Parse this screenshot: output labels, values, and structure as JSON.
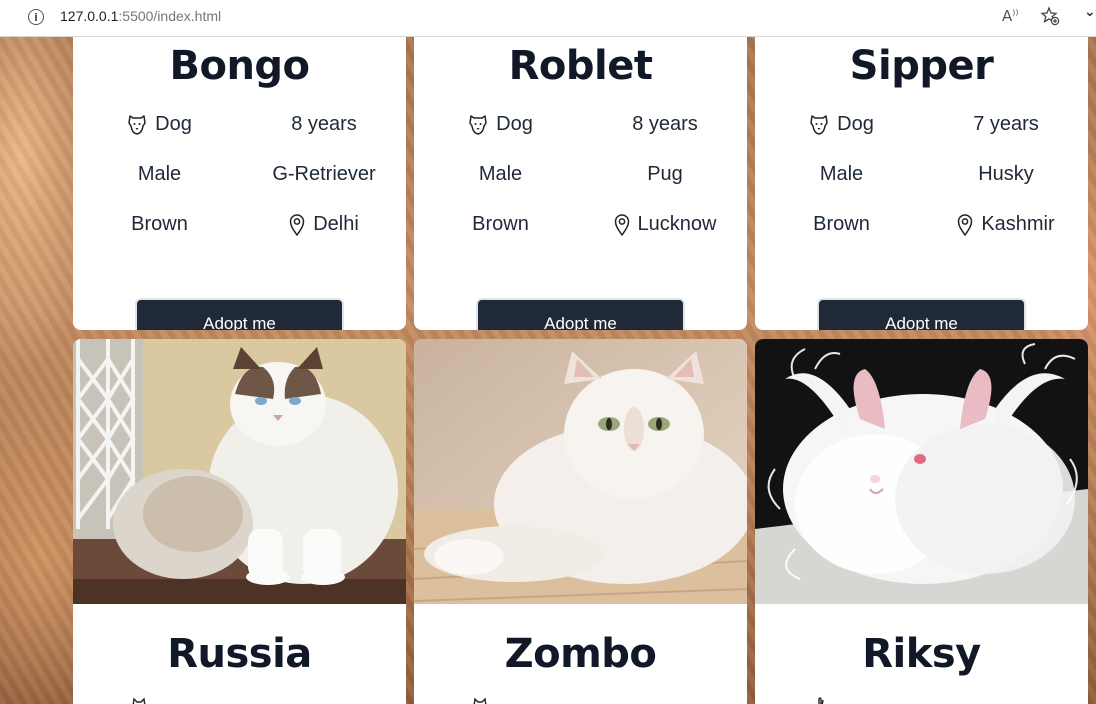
{
  "browser": {
    "url_host": "127.0.0.1",
    "url_rest": ":5500/index.html"
  },
  "top_cards": [
    {
      "name": "Bongo",
      "species": "Dog",
      "age": "8 years",
      "gender": "Male",
      "breed": "G-Retriever",
      "color": "Brown",
      "location": "Delhi",
      "button": "Adopt me"
    },
    {
      "name": "Roblet",
      "species": "Dog",
      "age": "8 years",
      "gender": "Male",
      "breed": "Pug",
      "color": "Brown",
      "location": "Lucknow",
      "button": "Adopt me"
    },
    {
      "name": "Sipper",
      "species": "Dog",
      "age": "7 years",
      "gender": "Male",
      "breed": "Husky",
      "color": "Brown",
      "location": "Kashmir",
      "button": "Adopt me"
    }
  ],
  "bottom_cards": [
    {
      "name": "Russia",
      "photo": "ragdoll-cat"
    },
    {
      "name": "Zombo",
      "photo": "white-persian-cat"
    },
    {
      "name": "Riksy",
      "photo": "white-angora-rabbit"
    }
  ],
  "colors": {
    "button_bg": "#1f2937",
    "heading": "#111827"
  }
}
